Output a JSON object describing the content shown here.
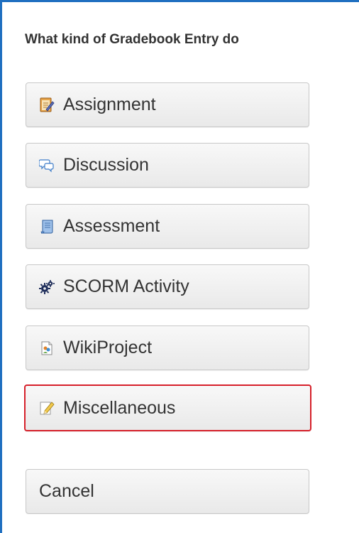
{
  "dialog": {
    "prompt": "What kind of Gradebook Entry do",
    "options": [
      {
        "label": "Assignment",
        "icon": "assignment-icon"
      },
      {
        "label": "Discussion",
        "icon": "discussion-icon"
      },
      {
        "label": "Assessment",
        "icon": "assessment-icon"
      },
      {
        "label": "SCORM Activity",
        "icon": "scorm-gear-icon"
      },
      {
        "label": "WikiProject",
        "icon": "wikiproject-icon"
      },
      {
        "label": "Miscellaneous",
        "icon": "miscellaneous-pencil-icon",
        "highlighted": true
      }
    ],
    "cancel_label": "Cancel"
  },
  "colors": {
    "frame_border": "#1f6fc0",
    "highlight_border": "#d6202a",
    "button_bg": "#f0f0f0",
    "text": "#333333"
  }
}
